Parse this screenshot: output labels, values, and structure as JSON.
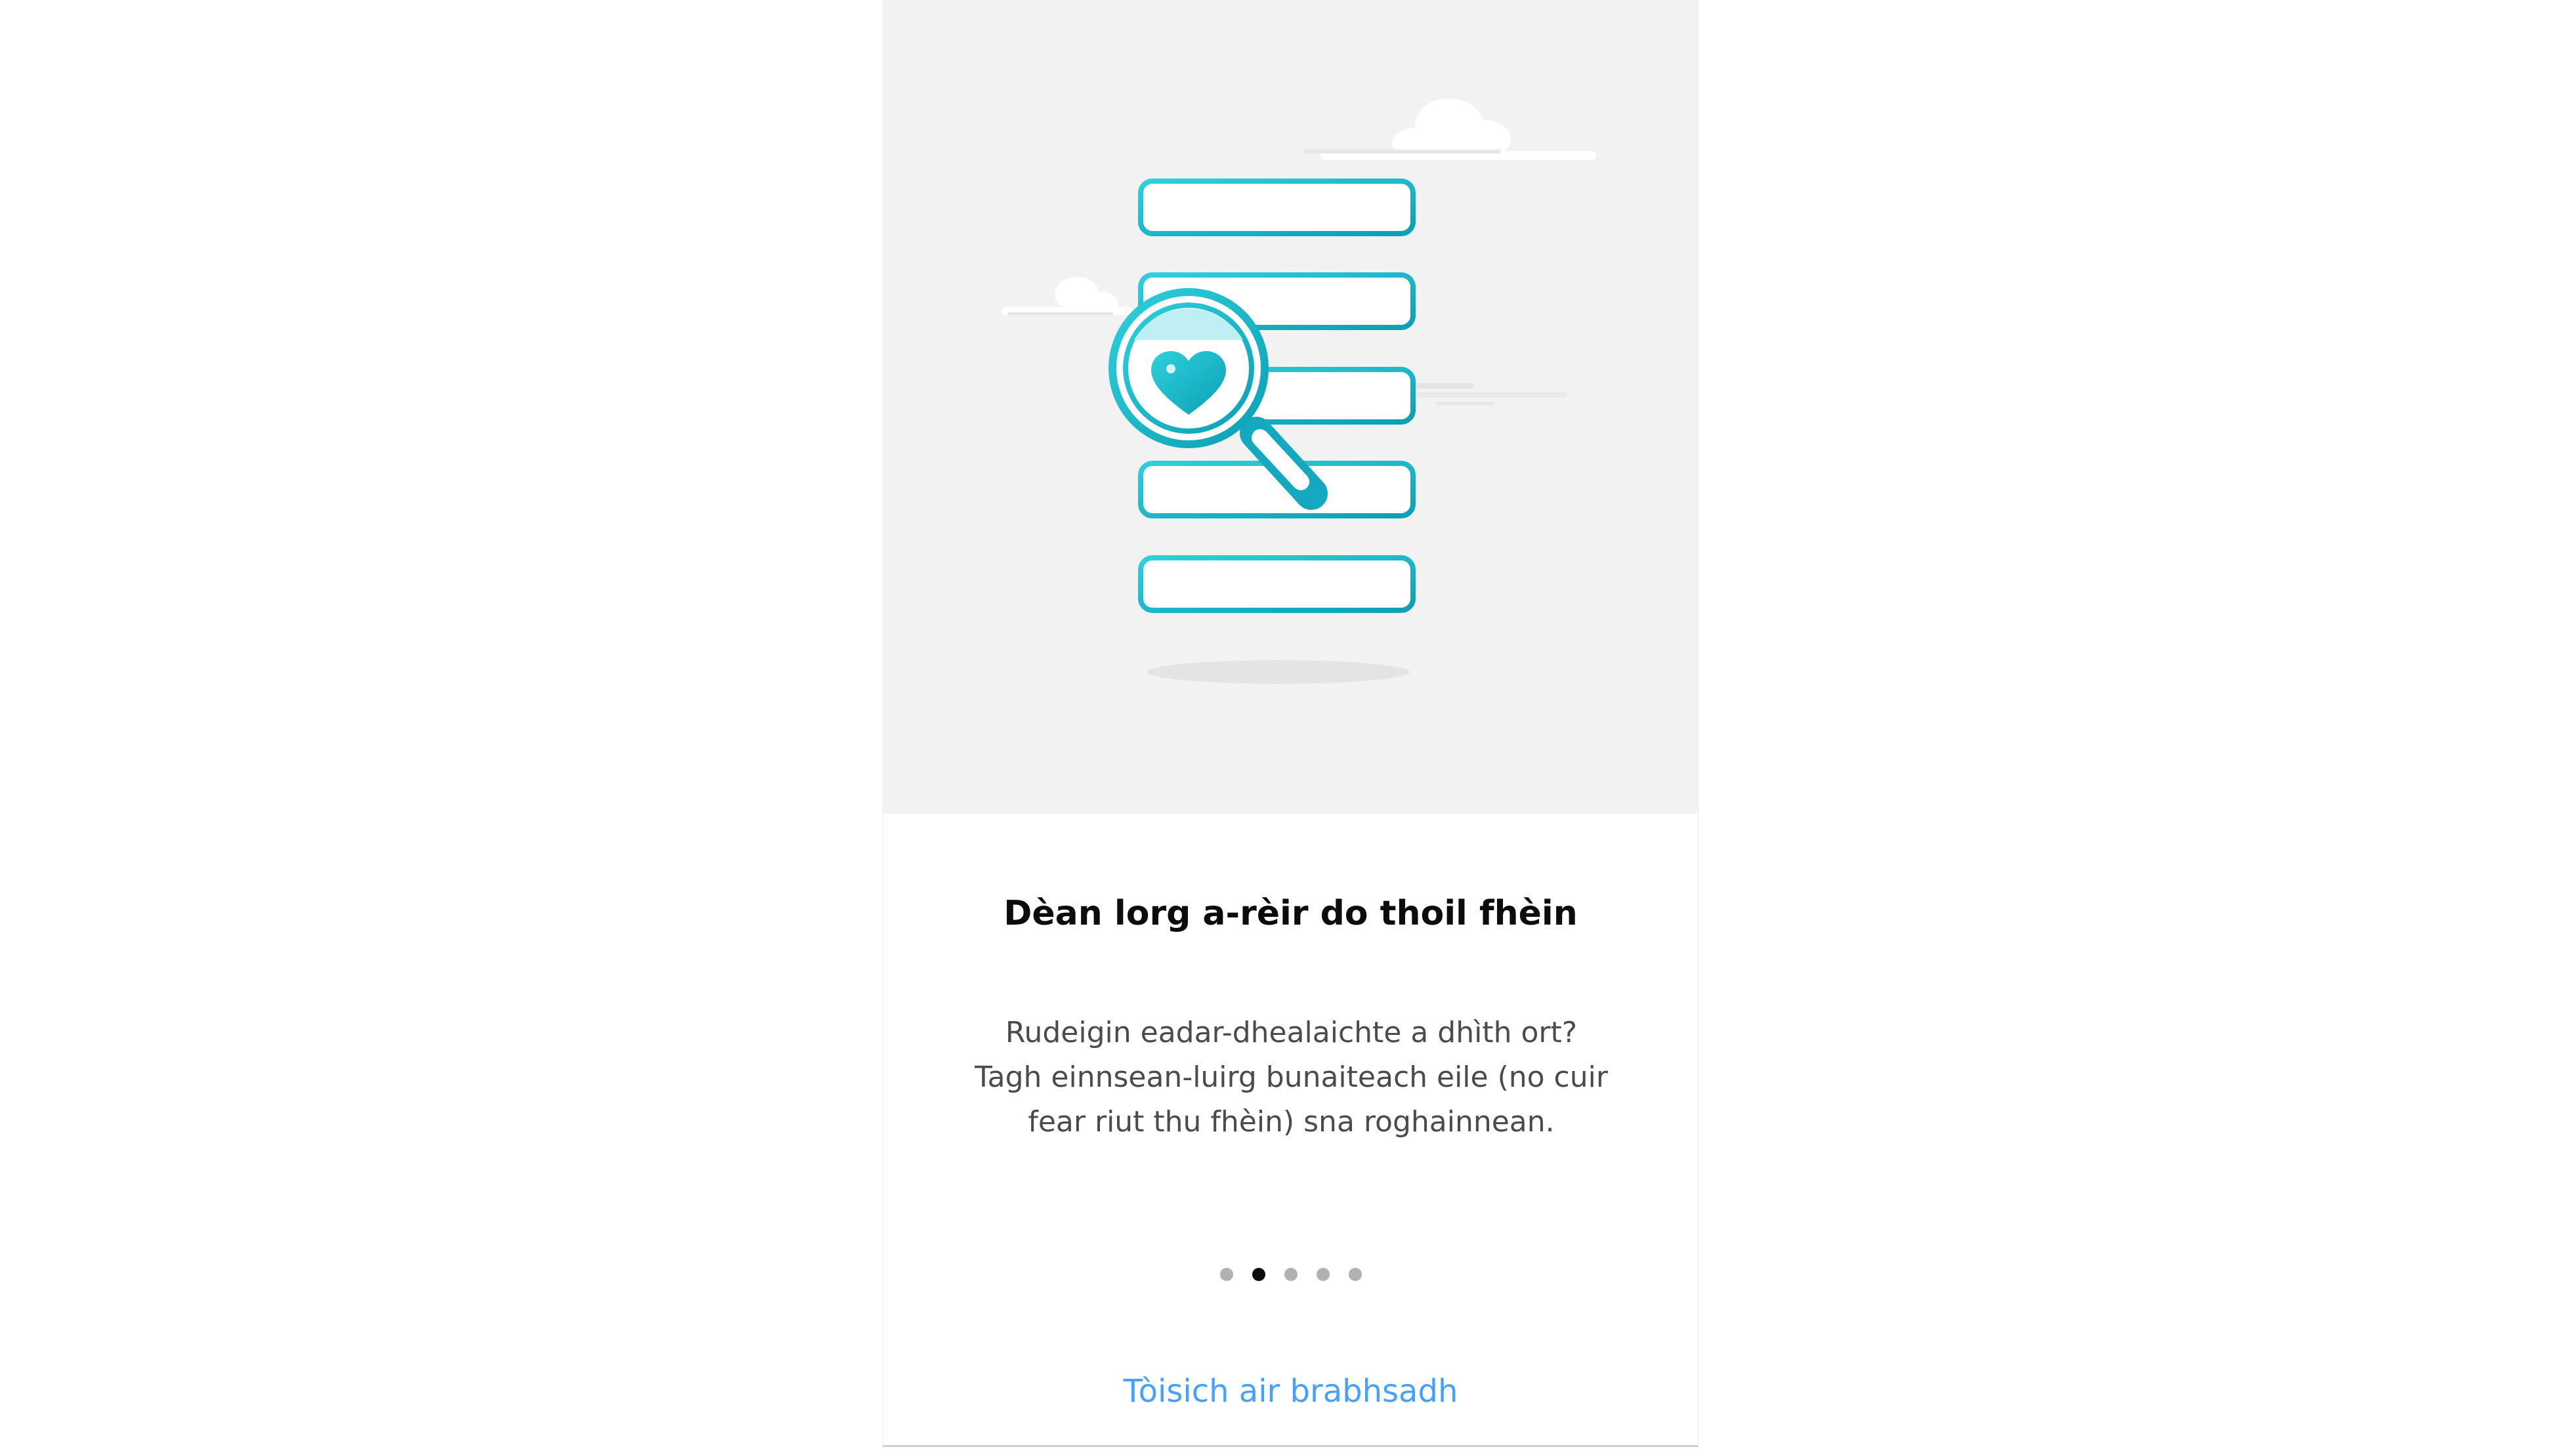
{
  "onboarding": {
    "title": "Dèan lorg a-rèir do thoil fhèin",
    "description_lines": [
      "Rudeigin eadar-dhealaichte a dhìth ort?",
      "Tagh einnsean-luirg bunaiteach eile (no cuir",
      "fear riut thu fhèin) sna roghainnean."
    ],
    "page_count": 5,
    "current_page": 2,
    "start_button_label": "Tòisich air brabhsadh",
    "illustration_icon": "search-list-magnifier-heart-icon"
  },
  "colors": {
    "hero_background": "#f2f2f2",
    "accent_teal": "#14b3c9",
    "link_blue": "#45a1ff",
    "title_text": "#0c0c0d",
    "body_text": "#4a4a4f",
    "dot_inactive": "#b1b1b3",
    "dot_active": "#0c0c0d"
  }
}
